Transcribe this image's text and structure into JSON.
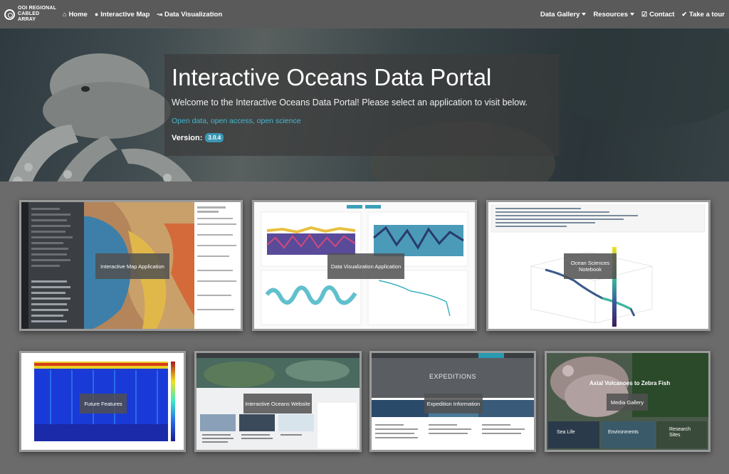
{
  "nav": {
    "brand": {
      "line1": "OOI REGIONAL",
      "line2": "CABLED ARRAY"
    },
    "left": [
      {
        "icon": "home-icon",
        "label": "Home"
      },
      {
        "icon": "globe-icon",
        "label": "Interactive Map"
      },
      {
        "icon": "chart-line-icon",
        "label": "Data Visualization"
      }
    ],
    "right": [
      {
        "label": "Data Gallery",
        "dropdown": true
      },
      {
        "label": "Resources",
        "dropdown": true
      },
      {
        "icon": "check-square-icon",
        "label": "Contact"
      },
      {
        "icon": "check-circle-icon",
        "label": "Take a tour"
      }
    ]
  },
  "hero": {
    "title": "Interactive Oceans Data Portal",
    "subtitle": "Welcome to the Interactive Oceans Data Portal! Please select an application to visit below.",
    "tagline": "Open data, open access, open science",
    "version_label": "Version:",
    "version": "3.0.4"
  },
  "apps": {
    "map": {
      "label": "Interactive Map Application"
    },
    "dataviz": {
      "label": "Data Visualization Application"
    },
    "notebook": {
      "label": "Ocean Sciences Notebook"
    },
    "future": {
      "label": "Future Features"
    },
    "website": {
      "label": "Interactive Oceans Website"
    },
    "expedition": {
      "label": "Expedition Information",
      "banner": "EXPEDITIONS"
    },
    "media": {
      "label": "Media Gallery",
      "title": "Axial Volcanoes to Zebra Fish",
      "tiles": [
        "Sea Life",
        "Environments",
        "Research Sites"
      ]
    }
  },
  "colors": {
    "nav_bg": "#5a5a5a",
    "accent": "#43b8d0",
    "badge": "#3a97b4"
  }
}
